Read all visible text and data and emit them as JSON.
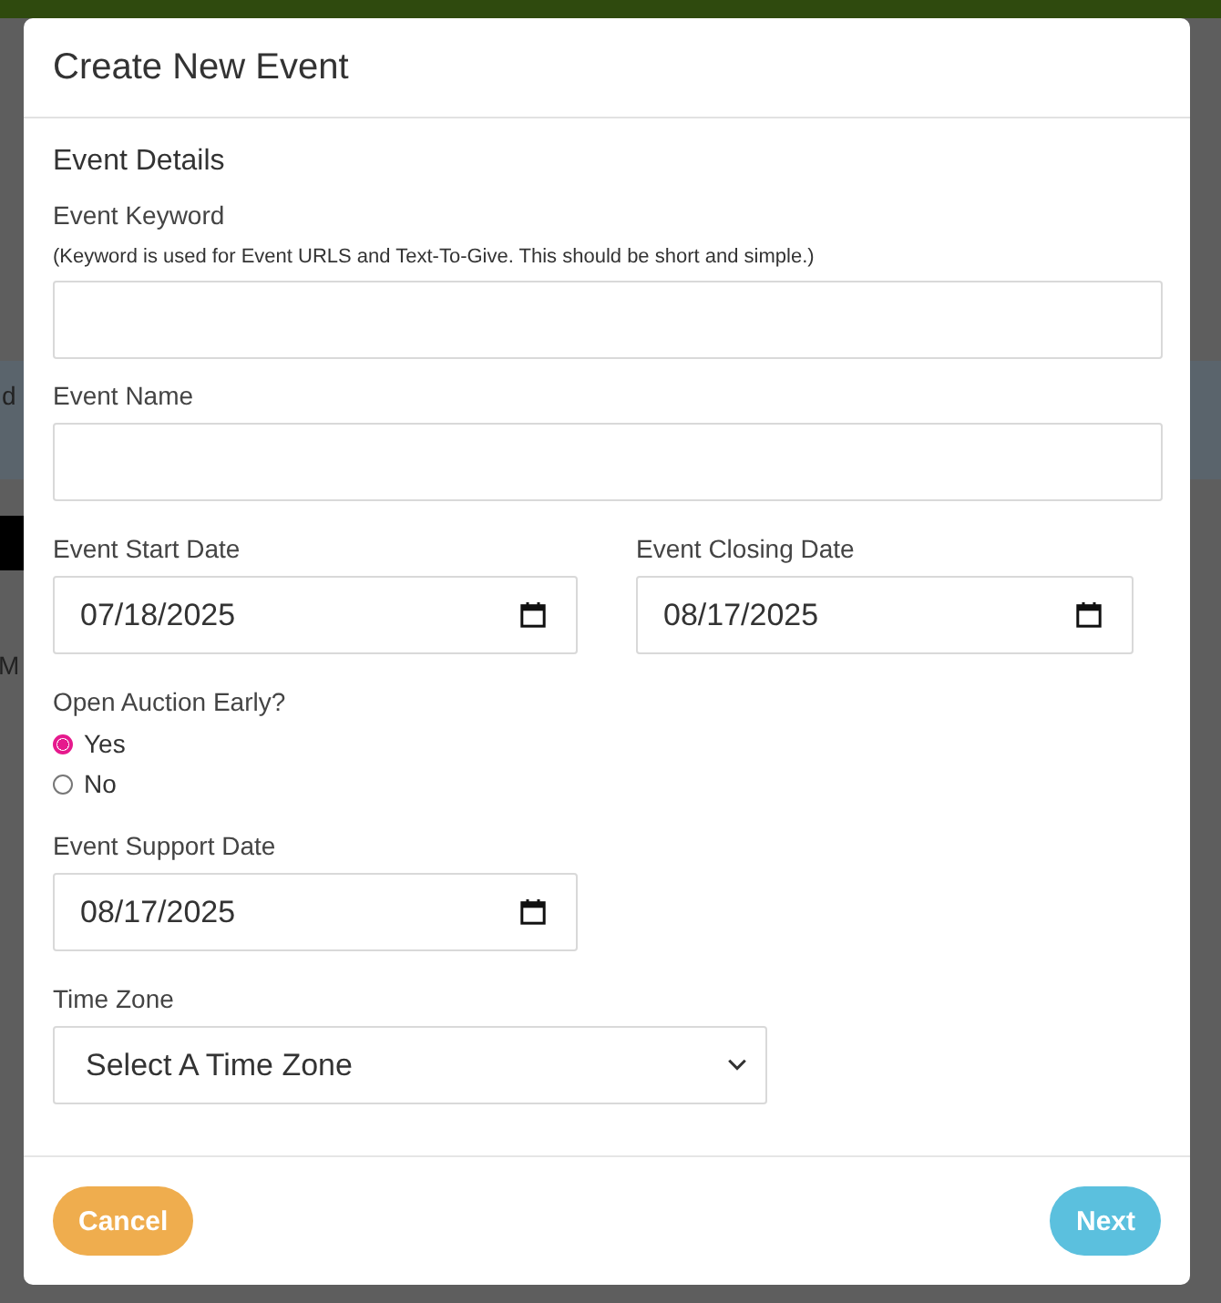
{
  "background": {
    "fragments": [
      "d",
      "M"
    ]
  },
  "dialog": {
    "title": "Create New Event",
    "section": "Event Details",
    "keyword": {
      "label": "Event Keyword",
      "hint": "(Keyword is used for Event URLS and Text-To-Give. This should be short and simple.)"
    },
    "name": {
      "label": "Event Name"
    },
    "start_date": {
      "label": "Event Start Date",
      "value": "07/18/2025"
    },
    "closing_date": {
      "label": "Event Closing Date",
      "value": "08/17/2025"
    },
    "open_early": {
      "label": "Open Auction Early?",
      "options": [
        {
          "label": "Yes",
          "selected": true
        },
        {
          "label": "No",
          "selected": false
        }
      ]
    },
    "support_date": {
      "label": "Event Support Date",
      "value": "08/17/2025"
    },
    "time_zone": {
      "label": "Time Zone",
      "value": "Select A Time Zone"
    },
    "buttons": [
      {
        "label": "Cancel",
        "kind": "cancel"
      },
      {
        "label": "Next",
        "kind": "next"
      }
    ]
  }
}
